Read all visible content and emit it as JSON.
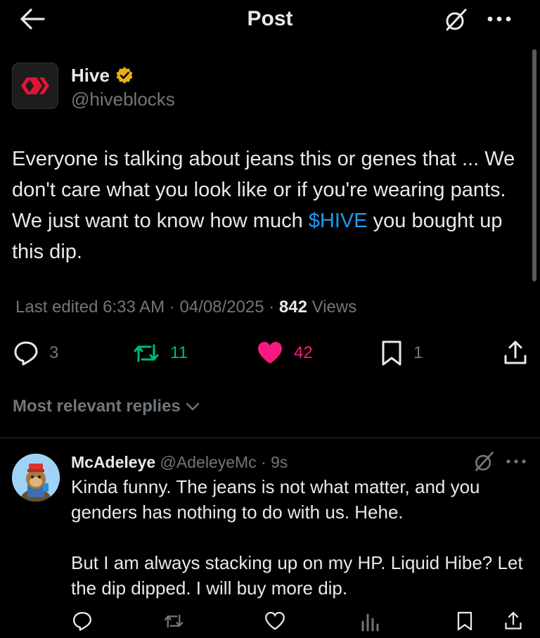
{
  "header": {
    "title": "Post",
    "back_icon": "arrow-left-icon",
    "grok_icon": "grok-icon",
    "more_icon": "more-horizontal-icon"
  },
  "post": {
    "author": {
      "name": "Hive",
      "handle": "@hiveblocks",
      "verified": true,
      "avatar_icon": "hive-logo",
      "brand_color": "#e31337"
    },
    "text_before": "Everyone is talking about jeans this or genes that ... We don't care what you look like or if you're wearing pants. We just want to know how much ",
    "cashtag": "$HIVE",
    "text_after": " you bought up this dip.",
    "meta": {
      "edited_label": "Last edited 6:33 AM · 04/08/2025 · ",
      "views_count": "842",
      "views_label": " Views"
    },
    "actions": {
      "replies": "3",
      "reposts": "11",
      "likes": "42",
      "bookmarks": "1"
    }
  },
  "replies_filter": {
    "label": "Most relevant replies"
  },
  "reply": {
    "name": "McAdeleye",
    "handle_time": " @AdeleyeMc · 9s",
    "text": "Kinda funny. The jeans is not what matter, and you genders has nothing to do with us. Hehe.\n\nBut I am always stacking up on my HP. Liquid Hibe? Let the dip dipped. I will buy more dip."
  },
  "colors": {
    "background": "#000000",
    "text": "#e7e9ea",
    "secondary": "#71767b",
    "link": "#1d9bf0",
    "repost": "#00ba7c",
    "like": "#f91880",
    "verified_badge": "#e8b10e"
  }
}
